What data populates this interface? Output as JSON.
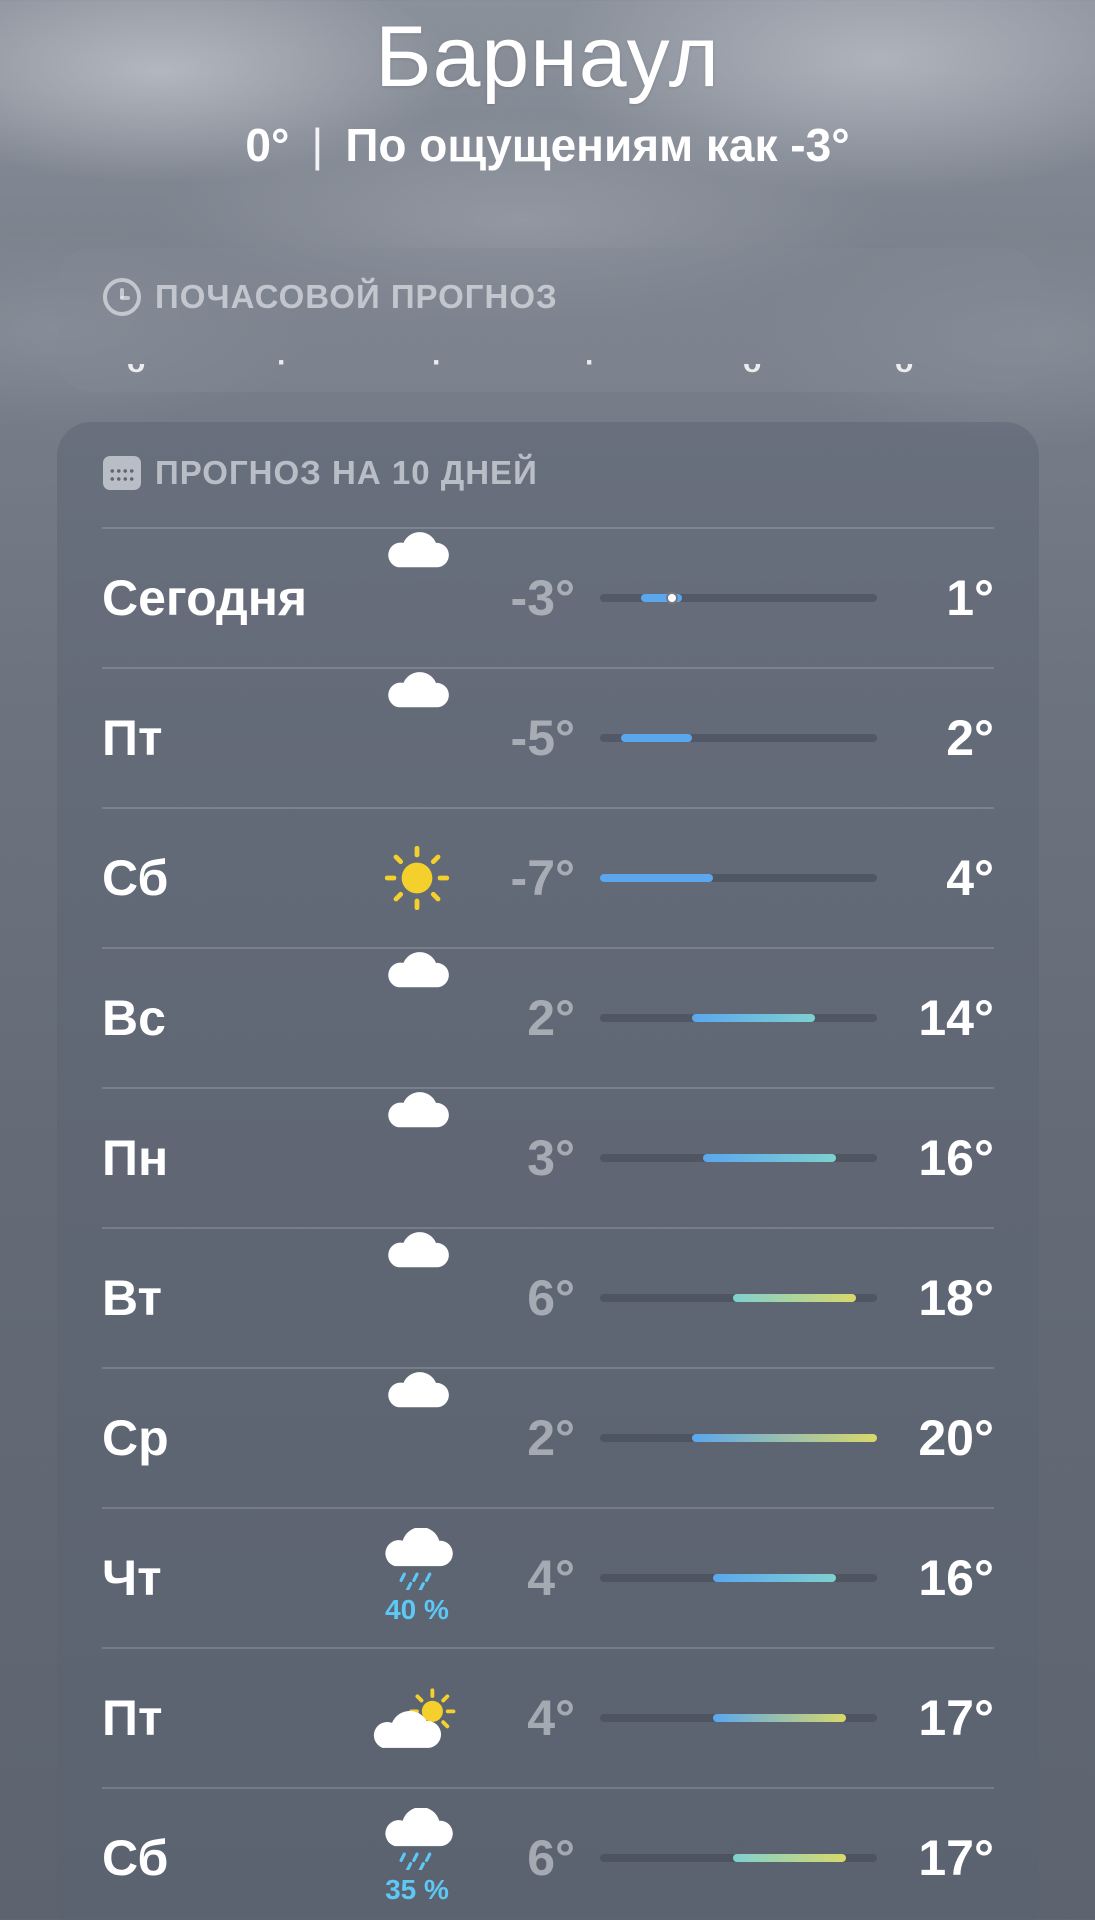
{
  "location": {
    "city": "Барнаул",
    "current_temp": "0°",
    "separator": "|",
    "feels_like": "По ощущениям как -3°"
  },
  "hourly": {
    "title": "ПОЧАСОВОЙ ПРОГНОЗ",
    "icon": "clock-icon"
  },
  "daily": {
    "title": "ПРОГНОЗ НА 10 ДНЕЙ",
    "icon": "calendar-icon",
    "range": {
      "min": -7,
      "max": 20
    },
    "current_temp": 0,
    "days": [
      {
        "day": "Сегодня",
        "icon": "cloud-icon",
        "low": "-3°",
        "high": "1°",
        "low_v": -3,
        "high_v": 1,
        "precip": ""
      },
      {
        "day": "Пт",
        "icon": "cloud-icon",
        "low": "-5°",
        "high": "2°",
        "low_v": -5,
        "high_v": 2,
        "precip": ""
      },
      {
        "day": "Сб",
        "icon": "sun-icon",
        "low": "-7°",
        "high": "4°",
        "low_v": -7,
        "high_v": 4,
        "precip": ""
      },
      {
        "day": "Вс",
        "icon": "cloud-icon",
        "low": "2°",
        "high": "14°",
        "low_v": 2,
        "high_v": 14,
        "precip": ""
      },
      {
        "day": "Пн",
        "icon": "cloud-icon",
        "low": "3°",
        "high": "16°",
        "low_v": 3,
        "high_v": 16,
        "precip": ""
      },
      {
        "day": "Вт",
        "icon": "cloud-icon",
        "low": "6°",
        "high": "18°",
        "low_v": 6,
        "high_v": 18,
        "precip": ""
      },
      {
        "day": "Ср",
        "icon": "cloud-icon",
        "low": "2°",
        "high": "20°",
        "low_v": 2,
        "high_v": 20,
        "precip": ""
      },
      {
        "day": "Чт",
        "icon": "cloud-rain-icon",
        "low": "4°",
        "high": "16°",
        "low_v": 4,
        "high_v": 16,
        "precip": "40 %"
      },
      {
        "day": "Пт",
        "icon": "cloud-sun-icon",
        "low": "4°",
        "high": "17°",
        "low_v": 4,
        "high_v": 17,
        "precip": ""
      },
      {
        "day": "Сб",
        "icon": "cloud-rain-icon",
        "low": "6°",
        "high": "17°",
        "low_v": 6,
        "high_v": 17,
        "precip": "35 %"
      }
    ]
  },
  "colors": {
    "precip_text": "#5ec7f5",
    "bar_cold": "#5aa7ee",
    "bar_mild": "#7fd0d0",
    "bar_warm": "#d9d86a",
    "sun": "#f5d02c"
  }
}
